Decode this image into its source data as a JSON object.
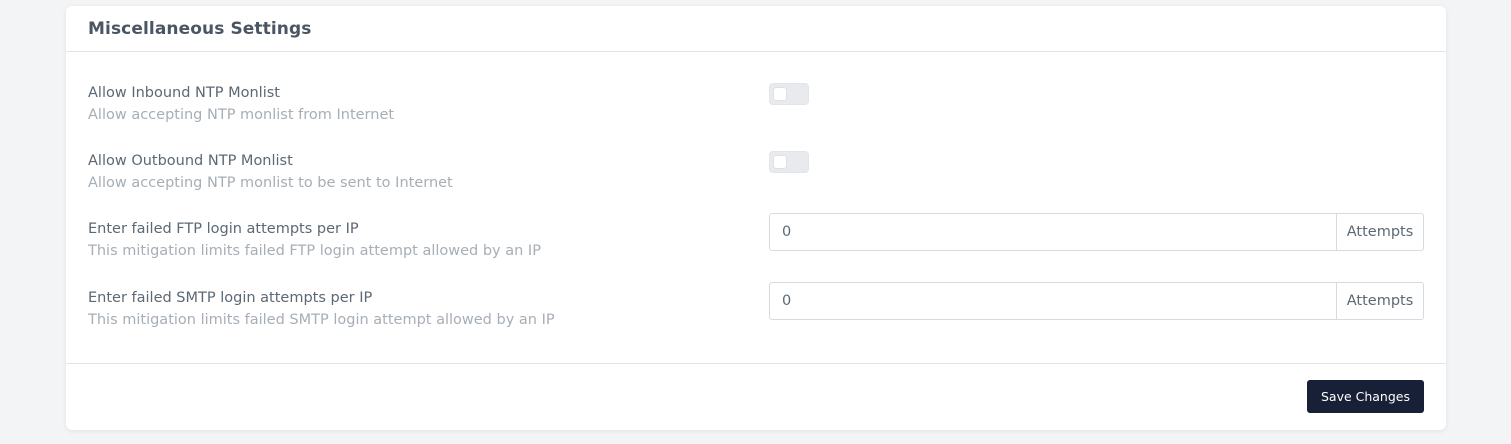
{
  "card": {
    "title": "Miscellaneous Settings"
  },
  "settings": [
    {
      "label": "Allow Inbound NTP Monlist",
      "description": "Allow accepting NTP monlist from Internet",
      "control": "toggle",
      "enabled": false
    },
    {
      "label": "Allow Outbound NTP Monlist",
      "description": "Allow accepting NTP monlist to be sent to Internet",
      "control": "toggle",
      "enabled": false
    },
    {
      "label": "Enter failed FTP login attempts per IP",
      "description": "This mitigation limits failed FTP login attempt allowed by an IP",
      "control": "number",
      "value": "0",
      "suffix": "Attempts"
    },
    {
      "label": "Enter failed SMTP login attempts per IP",
      "description": "This mitigation limits failed SMTP login attempt allowed by an IP",
      "control": "number",
      "value": "0",
      "suffix": "Attempts"
    }
  ],
  "footer": {
    "save_label": "Save Changes"
  },
  "colors": {
    "page_background": "#f3f4f5",
    "card_background": "#ffffff",
    "primary_button": "#172036",
    "label_text": "#5c6873",
    "description_text": "#a6aeb6",
    "toggle_off": "#e8eaed"
  }
}
